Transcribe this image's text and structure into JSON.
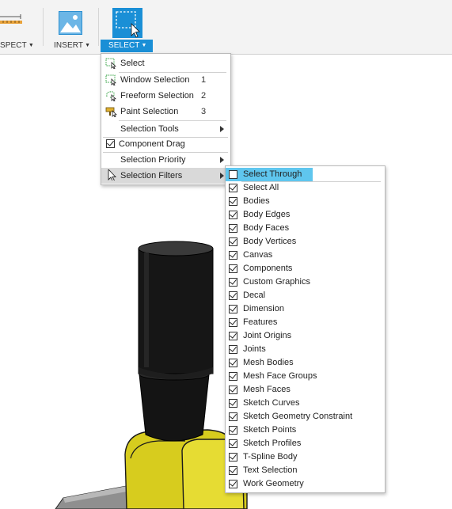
{
  "toolbar": {
    "inspect_label": "SPECT",
    "insert_label": "INSERT",
    "select_label": "SELECT",
    "accent_color": "#1a8fd6"
  },
  "select_menu": {
    "items": [
      {
        "label": "Select",
        "shortcut": "",
        "icon": "select-cursor-icon"
      },
      {
        "label": "Window Selection",
        "shortcut": "1",
        "icon": "window-selection-icon"
      },
      {
        "label": "Freeform Selection",
        "shortcut": "2",
        "icon": "freeform-selection-icon"
      },
      {
        "label": "Paint Selection",
        "shortcut": "3",
        "icon": "paint-selection-icon"
      },
      {
        "label": "Selection Tools",
        "submenu": true
      },
      {
        "label": "Component Drag",
        "checked": true
      },
      {
        "label": "Selection Priority",
        "submenu": true
      },
      {
        "label": "Selection Filters",
        "submenu": true,
        "highlighted": true
      }
    ]
  },
  "filters_menu": {
    "items": [
      {
        "label": "Select Through",
        "checked": false,
        "highlighted": true
      },
      {
        "label": "Select All",
        "checked": true
      },
      {
        "label": "Bodies",
        "checked": true
      },
      {
        "label": "Body Edges",
        "checked": true
      },
      {
        "label": "Body Faces",
        "checked": true
      },
      {
        "label": "Body Vertices",
        "checked": true
      },
      {
        "label": "Canvas",
        "checked": true
      },
      {
        "label": "Components",
        "checked": true
      },
      {
        "label": "Custom Graphics",
        "checked": true
      },
      {
        "label": "Decal",
        "checked": true
      },
      {
        "label": "Dimension",
        "checked": true
      },
      {
        "label": "Features",
        "checked": true
      },
      {
        "label": "Joint Origins",
        "checked": true
      },
      {
        "label": "Joints",
        "checked": true
      },
      {
        "label": "Mesh Bodies",
        "checked": true
      },
      {
        "label": "Mesh Face Groups",
        "checked": true
      },
      {
        "label": "Mesh Faces",
        "checked": true
      },
      {
        "label": "Sketch Curves",
        "checked": true
      },
      {
        "label": "Sketch Geometry Constraint",
        "checked": true
      },
      {
        "label": "Sketch Points",
        "checked": true
      },
      {
        "label": "Sketch Profiles",
        "checked": true
      },
      {
        "label": "T-Spline Body",
        "checked": true
      },
      {
        "label": "Text Selection",
        "checked": true
      },
      {
        "label": "Work Geometry",
        "checked": true
      }
    ]
  }
}
